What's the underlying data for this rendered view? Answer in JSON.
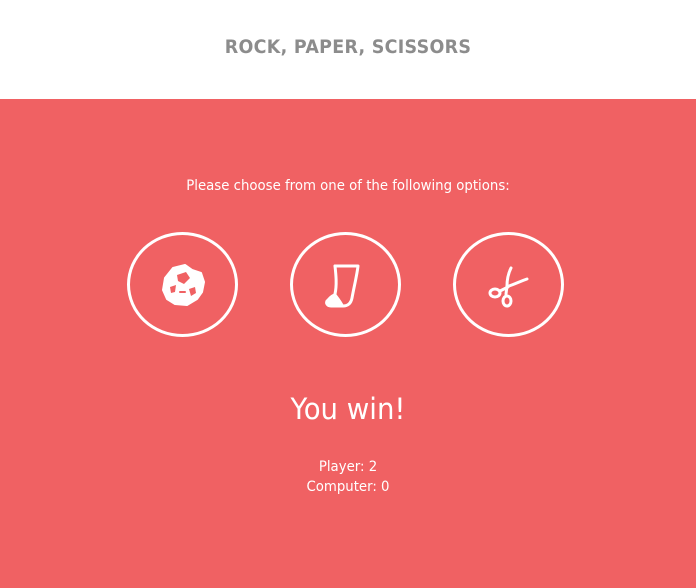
{
  "header": {
    "title": "ROCK, PAPER, SCISSORS"
  },
  "main": {
    "prompt": "Please choose from one of the following options:",
    "choices": [
      {
        "id": "rock",
        "icon": "rock-icon"
      },
      {
        "id": "paper",
        "icon": "paper-icon"
      },
      {
        "id": "scissors",
        "icon": "scissors-icon"
      }
    ],
    "result": "You win!",
    "scores": {
      "player": "Player: 2",
      "computer": "Computer: 0"
    }
  },
  "colors": {
    "background": "#f06163",
    "header_background": "#ffffff",
    "title": "#8c8c8c",
    "foreground": "#ffffff"
  }
}
